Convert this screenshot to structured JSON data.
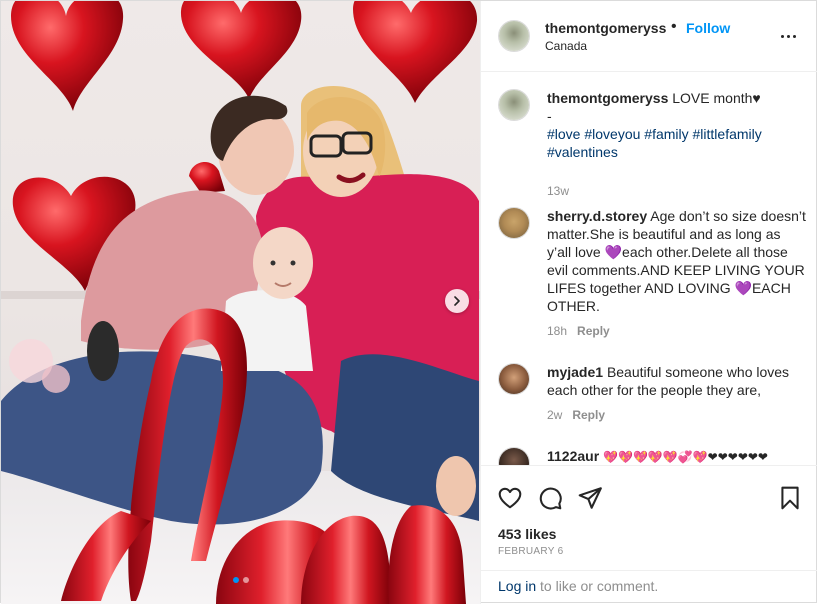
{
  "post": {
    "carousel_total": 2,
    "carousel_index": 1
  },
  "header": {
    "username": "themontgomeryss",
    "separator": "•",
    "follow_label": "Follow",
    "location": "Canada"
  },
  "caption": {
    "username": "themontgomeryss",
    "text_line1": "LOVE month♥",
    "text_line2": "-",
    "hashtags_line1": "#love #loveyou #family #littlefamily",
    "hashtags_line2": "#valentines",
    "age": "13w"
  },
  "comments": [
    {
      "username": "sherry.d.storey",
      "text_part1": "Age don’t so size doesn’t matter.She is beautiful and as long as y’all love ",
      "emoji1": "💜",
      "text_part2": "each other.Delete all those evil comments.AND KEEP LIVING YOUR LIFES together AND LOVING ",
      "emoji2": "💜",
      "text_part3": "EACH OTHER.",
      "age": "18h",
      "reply_label": "Reply"
    },
    {
      "username": "myjade1",
      "text": "Beautiful someone who loves each other for the people they are,",
      "age": "2w",
      "reply_label": "Reply"
    },
    {
      "username": "1122aur",
      "text": "💖💖💖💖💖💞💖❤❤❤❤❤❤"
    }
  ],
  "actions": {
    "likes": "453 likes",
    "date": "FEBRUARY 6"
  },
  "login": {
    "link_label": "Log in",
    "suffix": " to like or comment."
  },
  "colors": {
    "accent": "#0095f6",
    "hashtag": "#00376b",
    "muted": "#8e8e8e",
    "balloon_red": "#c8101c"
  },
  "icons": {
    "more": "more-dots-icon",
    "like": "heart-outline-icon",
    "comment": "comment-bubble-icon",
    "share": "paper-plane-icon",
    "save": "bookmark-icon",
    "next": "chevron-right-icon"
  }
}
